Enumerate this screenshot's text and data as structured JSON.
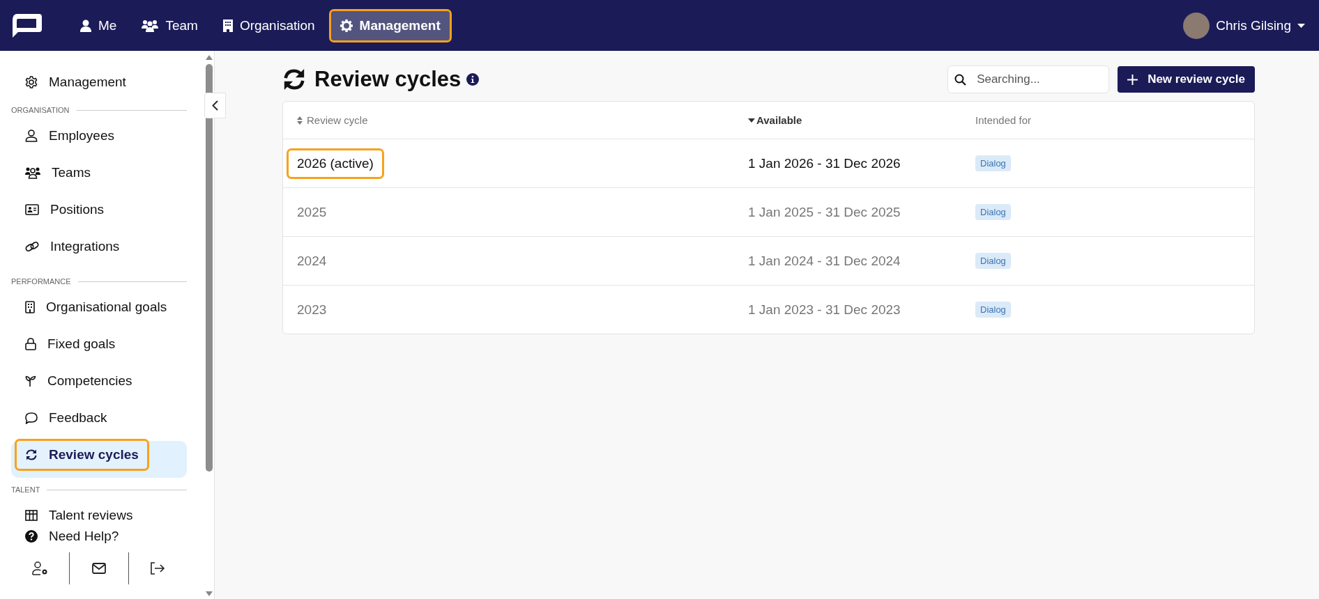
{
  "top_nav": {
    "items": [
      {
        "label": "Me",
        "selected": false,
        "highlighted": false
      },
      {
        "label": "Team",
        "selected": false,
        "highlighted": false
      },
      {
        "label": "Organisation",
        "selected": false,
        "highlighted": false
      },
      {
        "label": "Management",
        "selected": true,
        "highlighted": true
      }
    ],
    "user": {
      "name": "Chris Gilsing"
    }
  },
  "sidebar": {
    "top_item": {
      "label": "Management",
      "selected": false,
      "highlighted": false
    },
    "sections": [
      {
        "title": "ORGANISATION",
        "items": [
          {
            "label": "Employees",
            "selected": false,
            "highlighted": false
          },
          {
            "label": "Teams",
            "selected": false,
            "highlighted": false
          },
          {
            "label": "Positions",
            "selected": false,
            "highlighted": false
          },
          {
            "label": "Integrations",
            "selected": false,
            "highlighted": false
          }
        ]
      },
      {
        "title": "PERFORMANCE",
        "items": [
          {
            "label": "Organisational goals",
            "selected": false,
            "highlighted": false
          },
          {
            "label": "Fixed goals",
            "selected": false,
            "highlighted": false
          },
          {
            "label": "Competencies",
            "selected": false,
            "highlighted": false
          },
          {
            "label": "Feedback",
            "selected": false,
            "highlighted": false
          },
          {
            "label": "Review cycles",
            "selected": true,
            "highlighted": true
          }
        ]
      },
      {
        "title": "TALENT",
        "items": [
          {
            "label": "Talent reviews",
            "selected": false,
            "highlighted": false
          }
        ]
      }
    ],
    "help": "Need Help?"
  },
  "page": {
    "title": "Review cycles",
    "search": {
      "placeholder": "Searching..."
    },
    "new_button": "New review cycle"
  },
  "table": {
    "columns": [
      {
        "label": "Review cycle",
        "sortable": true,
        "sorted": false
      },
      {
        "label": "Available",
        "sortable": true,
        "sorted": true
      },
      {
        "label": "Intended for",
        "sortable": false,
        "sorted": false
      }
    ],
    "rows": [
      {
        "name": "2026 (active)",
        "period": "1 Jan 2026 - 31 Dec 2026",
        "tag": "Dialog",
        "active": true,
        "highlighted": true
      },
      {
        "name": "2025",
        "period": "1 Jan 2025 - 31 Dec 2025",
        "tag": "Dialog",
        "active": false,
        "highlighted": false
      },
      {
        "name": "2024",
        "period": "1 Jan 2024 - 31 Dec 2024",
        "tag": "Dialog",
        "active": false,
        "highlighted": false
      },
      {
        "name": "2023",
        "period": "1 Jan 2023 - 31 Dec 2023",
        "tag": "Dialog",
        "active": false,
        "highlighted": false
      }
    ]
  }
}
